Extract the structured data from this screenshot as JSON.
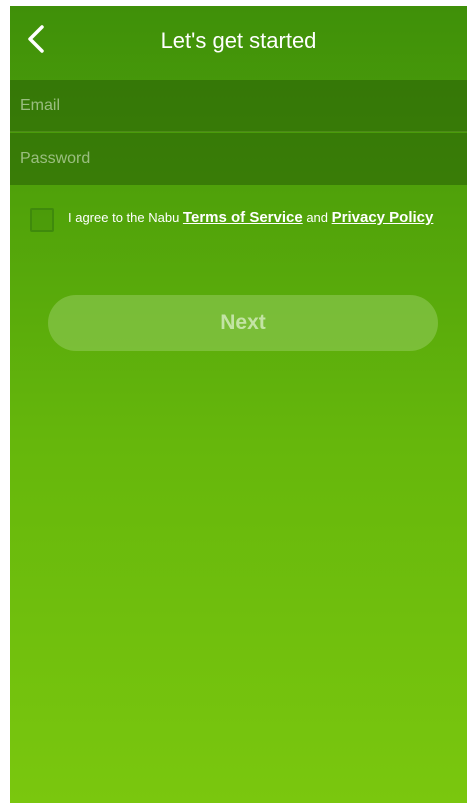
{
  "nav": {
    "back_icon": "chevron-left-icon",
    "title": "Let's get started"
  },
  "form": {
    "email_placeholder": "Email",
    "password_placeholder": "Password"
  },
  "agreement": {
    "prefix": "I agree to the Nabu ",
    "terms_label": "Terms of Service",
    "conjunction": " and ",
    "privacy_label": "Privacy Policy",
    "checked": false
  },
  "actions": {
    "next_label": "Next"
  },
  "colors": {
    "gradient_top": "#3f9009",
    "gradient_bottom": "#7ac70e",
    "text": "#ffffff"
  }
}
